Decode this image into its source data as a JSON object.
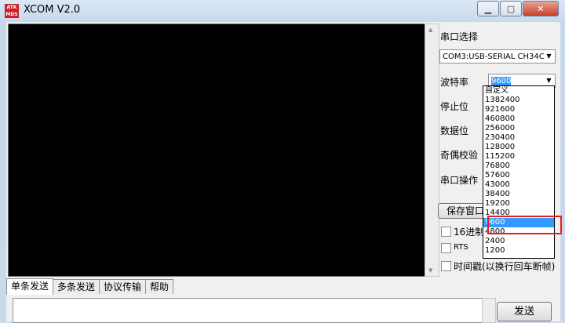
{
  "window": {
    "title": "XCOM V2.0",
    "logo_text": "ALIENTEK"
  },
  "panel": {
    "port_select_label": "串口选择",
    "port_value": "COM3:USB-SERIAL CH34C",
    "baud_label": "波特率",
    "baud_value": "9600",
    "stop_bits_label": "停止位",
    "data_bits_label": "数据位",
    "parity_label": "奇偶校验",
    "port_op_label": "串口操作",
    "save_window_label": "保存窗口",
    "hex_display_label": "16进制",
    "rts_label": "RTS",
    "timestamp_label": "时间戳(以换行回车断帧)"
  },
  "baud_options": [
    "自定义",
    "1382400",
    "921600",
    "460800",
    "256000",
    "230400",
    "128000",
    "115200",
    "76800",
    "57600",
    "43000",
    "38400",
    "19200",
    "14400",
    "9600",
    "4800",
    "2400",
    "1200"
  ],
  "selected_baud_index": 14,
  "tabs": [
    "单条发送",
    "多条发送",
    "协议传输",
    "帮助"
  ],
  "send_button_label": "发送",
  "colors": {
    "selection": "#3399ff",
    "highlight_box": "#e02020",
    "receive_bg": "#000000"
  }
}
